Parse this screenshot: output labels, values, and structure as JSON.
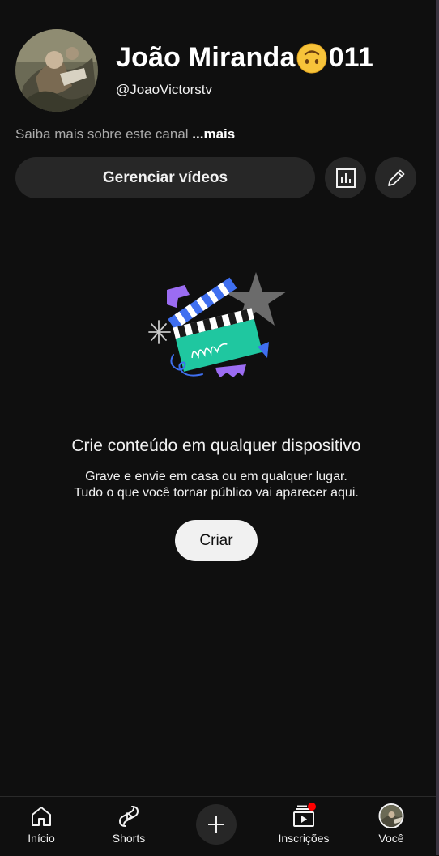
{
  "channel": {
    "name_prefix": "João Miranda",
    "name_suffix": " 011",
    "handle": "@JoaoVictorstv",
    "about_text": "Saiba mais sobre este canal ",
    "about_more": "...mais"
  },
  "actions": {
    "manage_label": "Gerenciar vídeos",
    "stats_icon": "analytics-icon",
    "edit_icon": "pencil-icon"
  },
  "empty_state": {
    "title": "Crie conteúdo em qualquer dispositivo",
    "line1": "Grave e envie em casa ou em qualquer lugar.",
    "line2": "Tudo o que você tornar público vai aparecer aqui.",
    "create_label": "Criar"
  },
  "bottom_nav": {
    "items": [
      {
        "label": "Início",
        "icon": "home-icon"
      },
      {
        "label": "Shorts",
        "icon": "shorts-icon"
      },
      {
        "label": "",
        "icon": "plus-icon"
      },
      {
        "label": "Inscrições",
        "icon": "subscriptions-icon",
        "has_notification": true
      },
      {
        "label": "Você",
        "icon": "avatar"
      }
    ]
  },
  "colors": {
    "background": "#0f0f0f",
    "surface": "#272727",
    "text": "#f1f1f1",
    "muted": "#aaaaaa",
    "notification": "#ff0000"
  }
}
